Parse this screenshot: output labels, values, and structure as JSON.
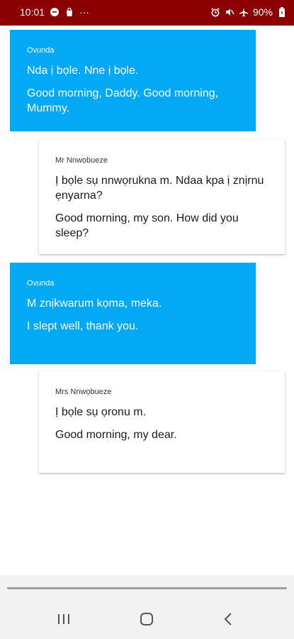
{
  "status_bar": {
    "time": "10:01",
    "more_indicator": "···",
    "battery_percent": "90%",
    "icons_left": [
      "chat-bubble-icon",
      "shopping-bag-icon"
    ],
    "icons_right": [
      "alarm-icon",
      "mute-icon",
      "airplane-icon",
      "battery-icon"
    ],
    "background": "#8b0000"
  },
  "conversation": [
    {
      "side": "left",
      "speaker": "Ovunda",
      "igbo": "Nda ị bọle. Nne ị bọle.",
      "english": "Good morning, Daddy. Good morning, Mummy."
    },
    {
      "side": "right",
      "speaker": "Mr Nnwọbueze",
      "igbo": "Ị bọle sụ nnwọrukna m. Ndaa kpa ị znịrnu ẹnyarna?",
      "english": "Good morning, my son. How did you sleep?"
    },
    {
      "side": "left",
      "speaker": "Ovunda",
      "igbo": "M znịkwarum kọma, meka.",
      "english": "I slept well, thank you."
    },
    {
      "side": "right",
      "speaker": "Mrs Nnwọbueze",
      "igbo": "Ị bọle sụ ọronu m.",
      "english": "Good morning, my dear."
    }
  ],
  "progress": {
    "fraction": 1.0
  },
  "nav_bar": {
    "buttons": [
      "recent-apps-icon",
      "home-icon",
      "back-icon"
    ]
  },
  "colors": {
    "accent_bubble": "#03a9f4",
    "status_bar": "#8b0000",
    "nav_bar": "#f2f2f2"
  }
}
